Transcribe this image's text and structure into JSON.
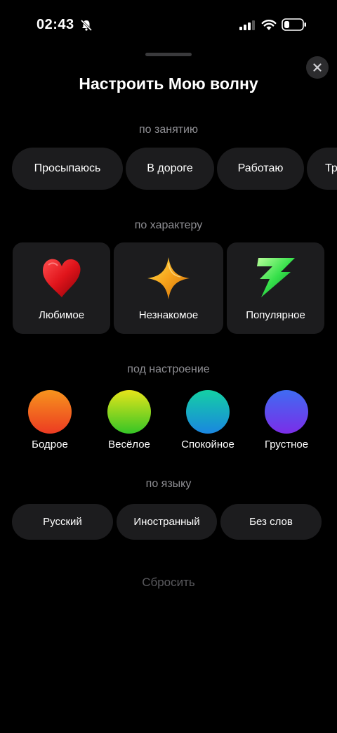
{
  "status_bar": {
    "time": "02:43"
  },
  "sheet": {
    "title": "Настроить Мою волну"
  },
  "activity": {
    "title": "по занятию",
    "chips": [
      "Просыпаюсь",
      "В дороге",
      "Работаю",
      "Тр"
    ]
  },
  "character": {
    "title": "по характеру",
    "cards": [
      {
        "label": "Любимое",
        "icon": "heart-icon"
      },
      {
        "label": "Незнакомое",
        "icon": "sparkle-icon"
      },
      {
        "label": "Популярное",
        "icon": "lightning-icon"
      }
    ]
  },
  "mood": {
    "title": "под настроение",
    "items": [
      {
        "label": "Бодрое",
        "color_top": "#f7941d",
        "color_bottom": "#ec3b22"
      },
      {
        "label": "Весёлое",
        "color_top": "#e6e51a",
        "color_bottom": "#35c526"
      },
      {
        "label": "Спокойное",
        "color_top": "#14d0a4",
        "color_bottom": "#1a86e0"
      },
      {
        "label": "Грустное",
        "color_top": "#3f6cf2",
        "color_bottom": "#7b2ee8"
      }
    ]
  },
  "language": {
    "title": "по языку",
    "chips": [
      "Русский",
      "Иностранный",
      "Без слов"
    ]
  },
  "reset_label": "Сбросить",
  "colors": {
    "background": "#000000",
    "surface": "#1c1c1e",
    "secondary_text": "#8e8e93"
  }
}
